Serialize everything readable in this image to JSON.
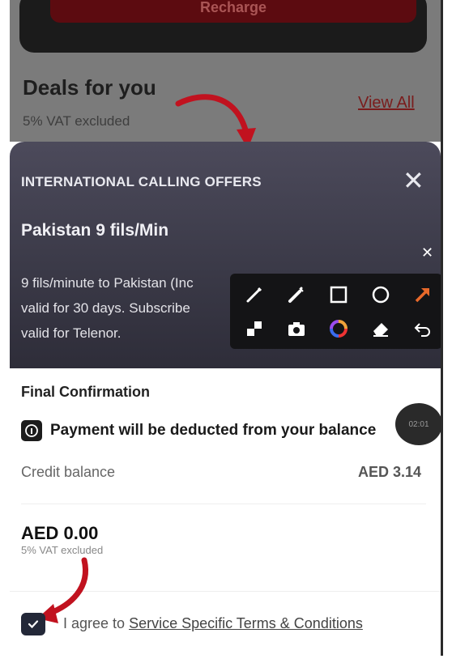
{
  "recharge": {
    "label": "Recharge"
  },
  "deals": {
    "title": "Deals for you",
    "subtitle": "5% VAT excluded",
    "view_all": "View All"
  },
  "offer": {
    "header": "INTERNATIONAL CALLING OFFERS",
    "title": "Pakistan 9 fils/Min",
    "desc_line1": "9 fils/minute to Pakistan (Inc",
    "desc_line2": "valid for 30 days. Subscribe",
    "desc_line3": "valid for Telenor."
  },
  "toolbar": {
    "tools": [
      "pen-icon",
      "highlighter-icon",
      "rectangle-icon",
      "circle-icon",
      "arrow-icon",
      "mosaic-icon",
      "camera-icon",
      "color-wheel-icon",
      "eraser-icon",
      "undo-icon"
    ],
    "arrow_color": "#e8692a"
  },
  "confirmation": {
    "title": "Final Confirmation",
    "payment_text": "Payment will be deducted from your balance",
    "timer": "02:01",
    "credit_label": "Credit balance",
    "credit_value": "AED 3.14",
    "total": "AED 0.00",
    "total_sub": "5% VAT excluded",
    "agree_prefix": "I agree to ",
    "agree_link": "Service Specific Terms & Conditions",
    "agree_checked": true
  },
  "colors": {
    "annotation_arrow": "#c1121f",
    "brand_red": "#5c0b10"
  }
}
